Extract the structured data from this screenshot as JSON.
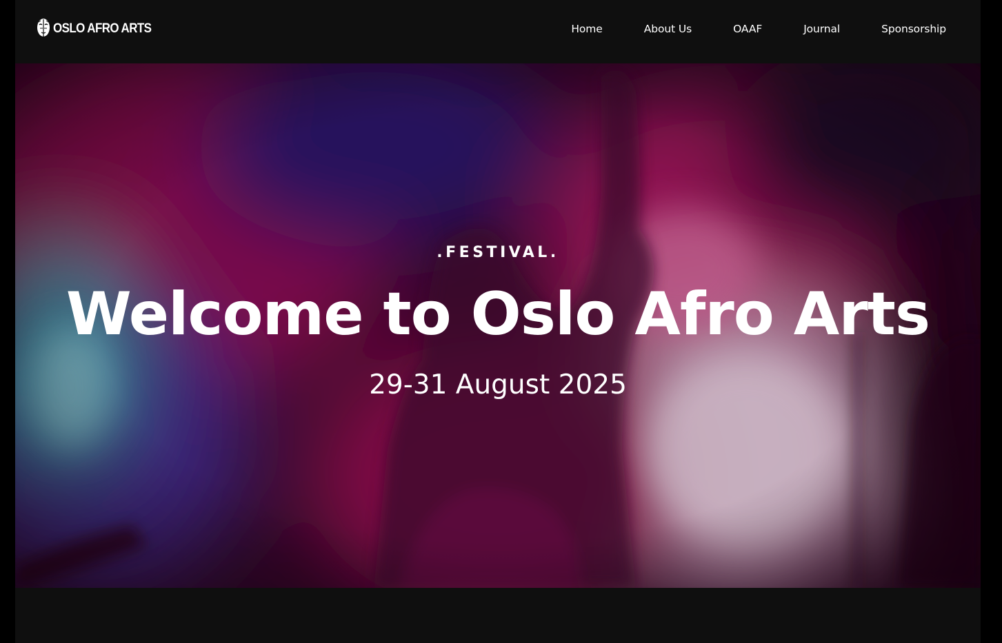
{
  "brand": {
    "name": "OSLO AFRO ARTS"
  },
  "nav": {
    "items": [
      {
        "label": "Home"
      },
      {
        "label": "About Us"
      },
      {
        "label": "OAAF"
      },
      {
        "label": "Journal"
      },
      {
        "label": "Sponsorship"
      }
    ]
  },
  "hero": {
    "eyebrow": ".FESTIVAL.",
    "title": "Welcome to Oslo Afro Arts",
    "date": "29-31 August 2025",
    "image": "concert-performer-photo"
  },
  "colors": {
    "header_bg": "#0f0f0f",
    "text": "#ffffff",
    "hero_magenta": "#8a0f4f",
    "hero_blue": "#2a2d8a",
    "hero_teal": "#2f8fa0"
  }
}
